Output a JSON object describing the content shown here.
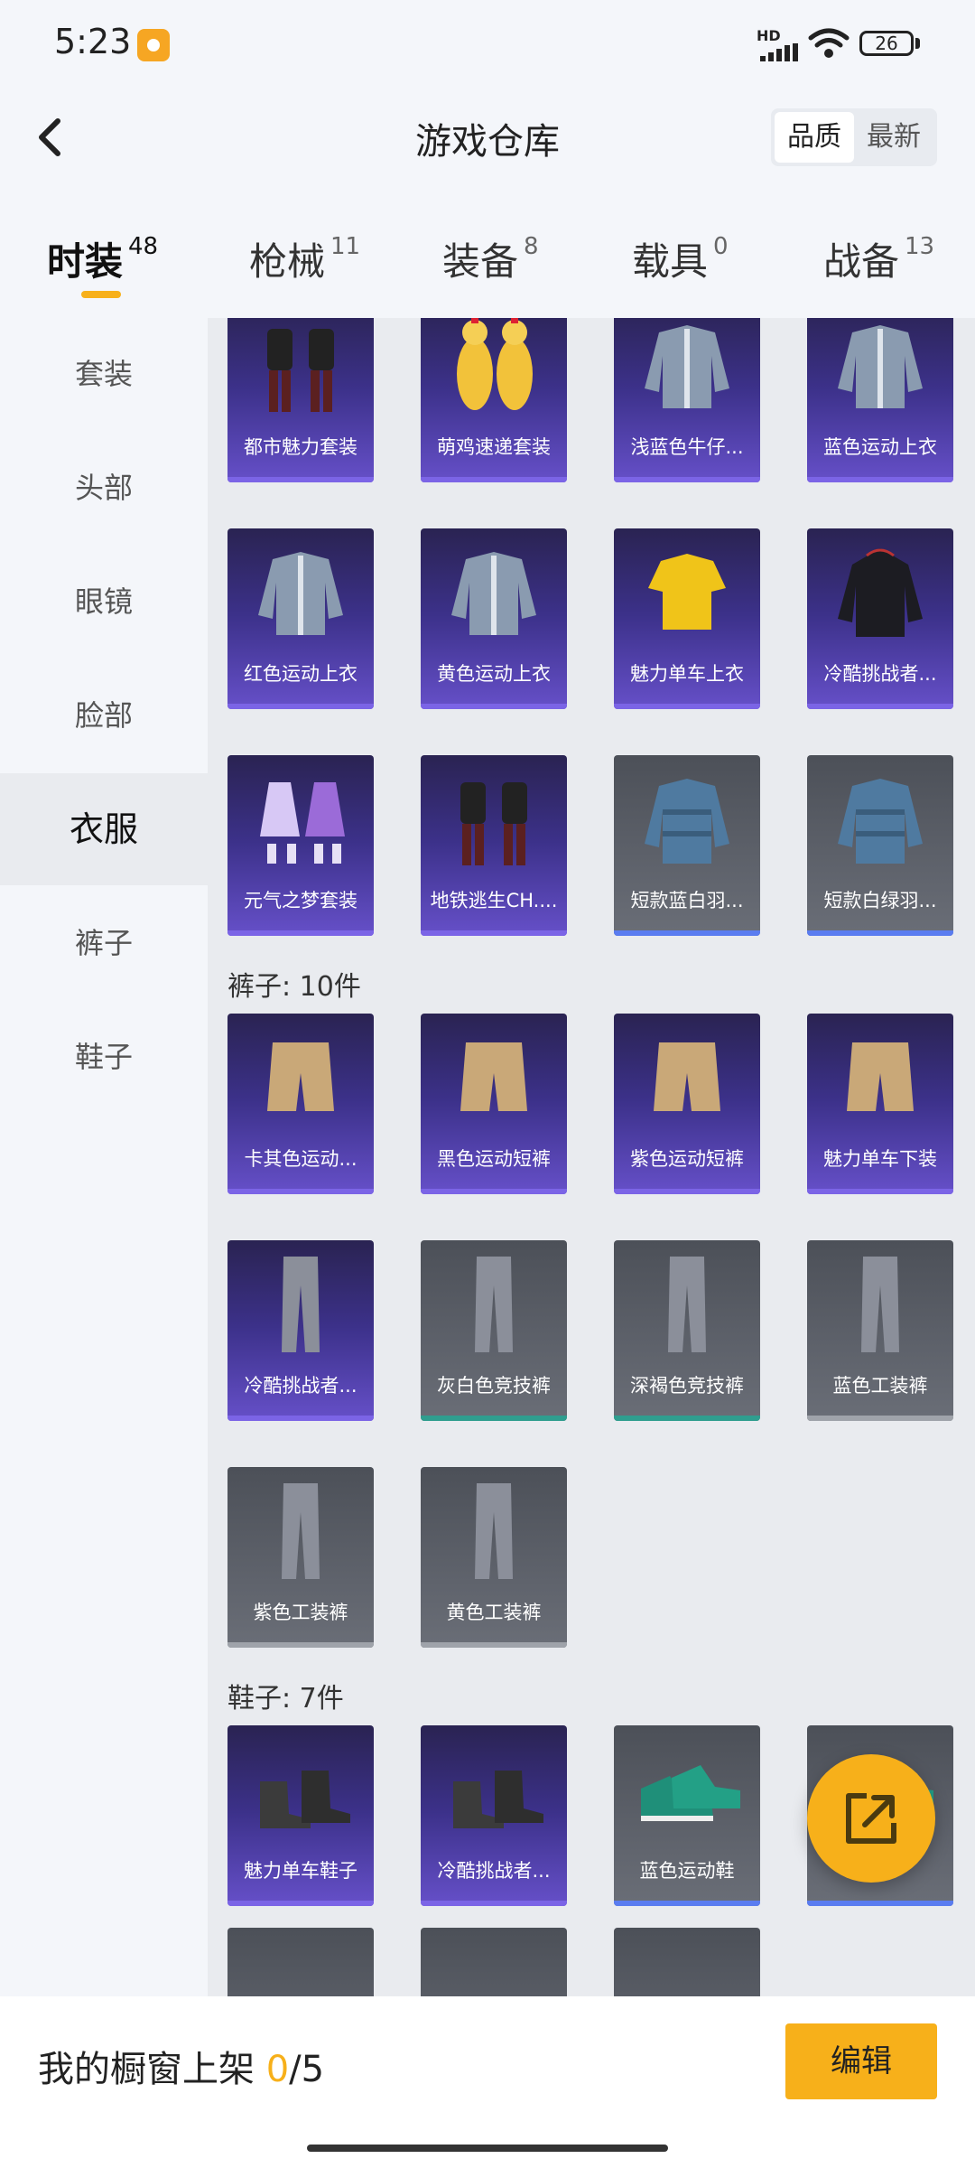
{
  "status": {
    "time": "5:23",
    "network": "HD",
    "battery": "26"
  },
  "header": {
    "title": "游戏仓库",
    "sort_quality": "品质",
    "sort_latest": "最新"
  },
  "colors": {
    "accent": "#f7b01a",
    "epic_card": "#3c318a",
    "common_card": "#5e626b"
  },
  "category_tabs": [
    {
      "label": "时装",
      "count": "48"
    },
    {
      "label": "枪械",
      "count": "11"
    },
    {
      "label": "装备",
      "count": "8"
    },
    {
      "label": "载具",
      "count": "0"
    },
    {
      "label": "战备",
      "count": "13"
    }
  ],
  "side_nav": [
    "套装",
    "头部",
    "眼镜",
    "脸部",
    "衣服",
    "裤子",
    "鞋子"
  ],
  "clothes_rows": [
    [
      {
        "name": "都市魅力套装",
        "rarity": "epic",
        "icon": "suit-icon"
      },
      {
        "name": "萌鸡速递套装",
        "rarity": "epic",
        "icon": "chicken-suit-icon"
      },
      {
        "name": "浅蓝色牛仔...",
        "rarity": "epic",
        "icon": "jacket-icon"
      },
      {
        "name": "蓝色运动上衣",
        "rarity": "epic",
        "icon": "jacket-icon"
      }
    ],
    [
      {
        "name": "红色运动上衣",
        "rarity": "epic",
        "icon": "jacket-icon"
      },
      {
        "name": "黄色运动上衣",
        "rarity": "epic",
        "icon": "jacket-icon"
      },
      {
        "name": "魅力单车上衣",
        "rarity": "epic",
        "icon": "shirt-icon"
      },
      {
        "name": "冷酷挑战者...",
        "rarity": "epic",
        "icon": "hoodie-icon"
      }
    ],
    [
      {
        "name": "元气之梦套装",
        "rarity": "epic",
        "icon": "dress-icon"
      },
      {
        "name": "地铁逃生CH....",
        "rarity": "epic",
        "icon": "suit-icon"
      },
      {
        "name": "短款蓝白羽...",
        "rarity": "rare",
        "icon": "down-jacket-icon"
      },
      {
        "name": "短款白绿羽...",
        "rarity": "rare",
        "icon": "down-jacket-icon"
      }
    ]
  ],
  "pants_title": "裤子: 10件",
  "pants_rows": [
    [
      {
        "name": "卡其色运动...",
        "rarity": "epic",
        "icon": "shorts-icon"
      },
      {
        "name": "黑色运动短裤",
        "rarity": "epic",
        "icon": "shorts-icon"
      },
      {
        "name": "紫色运动短裤",
        "rarity": "epic",
        "icon": "shorts-icon"
      },
      {
        "name": "魅力单车下装",
        "rarity": "epic",
        "icon": "shorts-icon"
      }
    ],
    [
      {
        "name": "冷酷挑战者...",
        "rarity": "epic",
        "icon": "pants-icon"
      },
      {
        "name": "灰白色竞技裤",
        "rarity": "uncommon",
        "icon": "pants-icon"
      },
      {
        "name": "深褐色竞技裤",
        "rarity": "uncommon",
        "icon": "pants-icon"
      },
      {
        "name": "蓝色工装裤",
        "rarity": "common",
        "icon": "pants-icon"
      }
    ],
    [
      {
        "name": "紫色工装裤",
        "rarity": "common",
        "icon": "pants-icon"
      },
      {
        "name": "黄色工装裤",
        "rarity": "common",
        "icon": "pants-icon"
      }
    ]
  ],
  "shoes_title": "鞋子: 7件",
  "shoes_rows": [
    [
      {
        "name": "魅力单车鞋子",
        "rarity": "epic",
        "icon": "boots-icon"
      },
      {
        "name": "冷酷挑战者...",
        "rarity": "epic",
        "icon": "boots-icon"
      },
      {
        "name": "蓝色运动鞋",
        "rarity": "rare",
        "icon": "sneaker-icon"
      },
      {
        "name": "",
        "rarity": "rare",
        "icon": "sneaker-icon"
      }
    ]
  ],
  "bottom": {
    "shelf_label": "我的橱窗上架 ",
    "shelf_current": "0",
    "shelf_total": "/5",
    "edit": "编辑"
  }
}
